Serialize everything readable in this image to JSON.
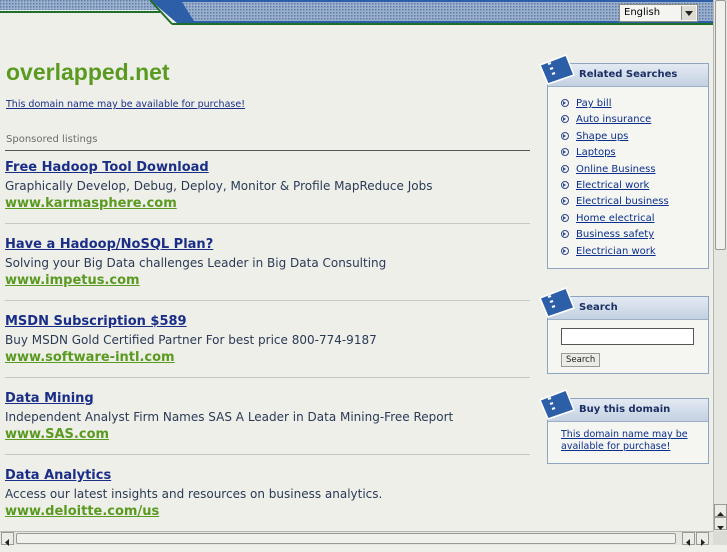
{
  "header": {
    "language": "English"
  },
  "main": {
    "title": "overlapped.net",
    "availability": "This domain name may be available for purchase!",
    "sponsored_label": "Sponsored listings",
    "listings": [
      {
        "title": "Free Hadoop Tool Download",
        "description": "Graphically Develop, Debug, Deploy, Monitor & Profile MapReduce Jobs",
        "url": "www.karmasphere.com"
      },
      {
        "title": "Have a Hadoop/NoSQL Plan?",
        "description": "Solving your Big Data challenges Leader in Big Data Consulting",
        "url": "www.impetus.com"
      },
      {
        "title": "MSDN Subscription $589",
        "description": "Buy MSDN Gold Certified Partner For best price 800-774-9187",
        "url": "www.software-intl.com"
      },
      {
        "title": "Data Mining",
        "description": "Independent Analyst Firm Names SAS A Leader in Data Mining-Free Report",
        "url": "www.SAS.com"
      },
      {
        "title": "Data Analytics",
        "description": "Access our latest insights and resources on business analytics.",
        "url": "www.deloitte.com/us"
      }
    ]
  },
  "sidebar": {
    "related": {
      "heading": "Related Searches",
      "items": [
        "Pay bill",
        "Auto insurance",
        "Shape ups",
        "Laptops",
        "Online Business",
        "Electrical work",
        "Electrical business",
        "Home electrical",
        "Business safety",
        "Electrician work"
      ]
    },
    "search": {
      "heading": "Search",
      "button_label": "Search"
    },
    "buy": {
      "heading": "Buy this domain",
      "text": "This domain name may be available for purchase!"
    }
  },
  "colors": {
    "brand_green": "#5a9a20",
    "link_blue": "#1a2e88",
    "panel_blue": "#2d5fa8"
  }
}
